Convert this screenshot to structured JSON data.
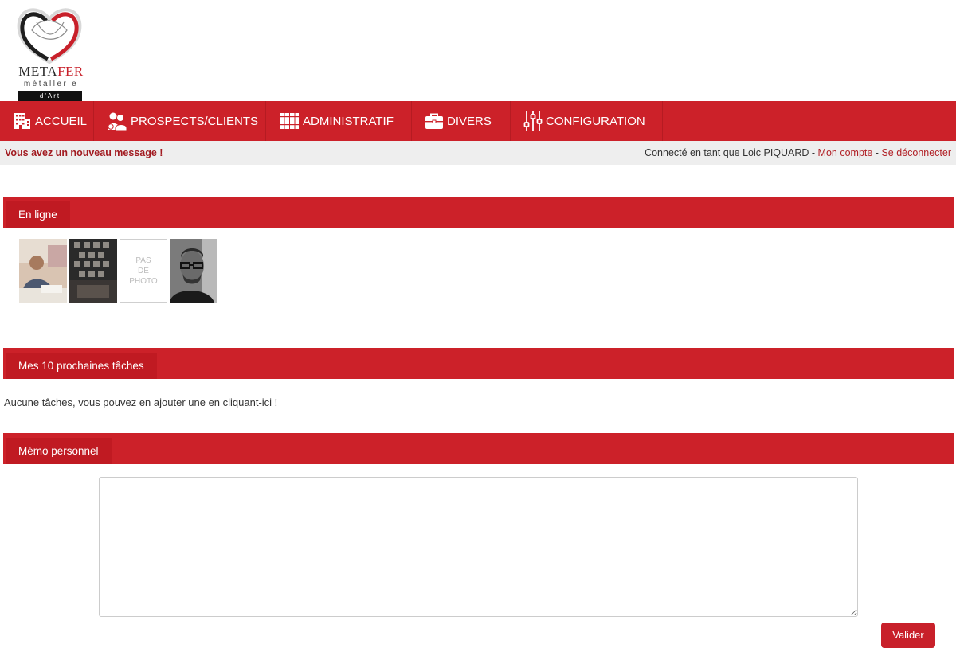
{
  "logo": {
    "brand_part1": "META",
    "brand_part2": "FER",
    "subtitle": "métallerie",
    "tagline": "d'Art",
    "colors": {
      "dark": "#2b2b2b",
      "red": "#c8202a"
    }
  },
  "nav": {
    "background": "#cc2129",
    "items": [
      {
        "label": "ACCUEIL",
        "icon": "building-icon"
      },
      {
        "label": "PROSPECTS/CLIENTS",
        "icon": "users-icon"
      },
      {
        "label": "ADMINISTRATIF",
        "icon": "books-icon"
      },
      {
        "label": "DIVERS",
        "icon": "briefcase-icon"
      },
      {
        "label": "CONFIGURATION",
        "icon": "sliders-icon"
      }
    ]
  },
  "statusbar": {
    "message": "Vous avez un nouveau message !",
    "connected_prefix": "Connecté en tant que Loic PIQUARD",
    "separator": " - ",
    "account_link": "Mon compte",
    "logout_link": "Se déconnecter"
  },
  "online": {
    "title": "En ligne",
    "users": [
      {
        "type": "photo",
        "icon": "user-photo"
      },
      {
        "type": "photo",
        "icon": "user-photo"
      },
      {
        "type": "placeholder",
        "line1": "PAS",
        "line2": "DE",
        "line3": "PHOTO"
      },
      {
        "type": "photo",
        "icon": "user-photo"
      }
    ]
  },
  "tasks": {
    "title": "Mes 10 prochaines tâches",
    "empty_text": "Aucune tâches, vous pouvez en ajouter une en cliquant-ici !"
  },
  "memo": {
    "title": "Mémo personnel",
    "value": "",
    "submit_label": "Valider"
  }
}
